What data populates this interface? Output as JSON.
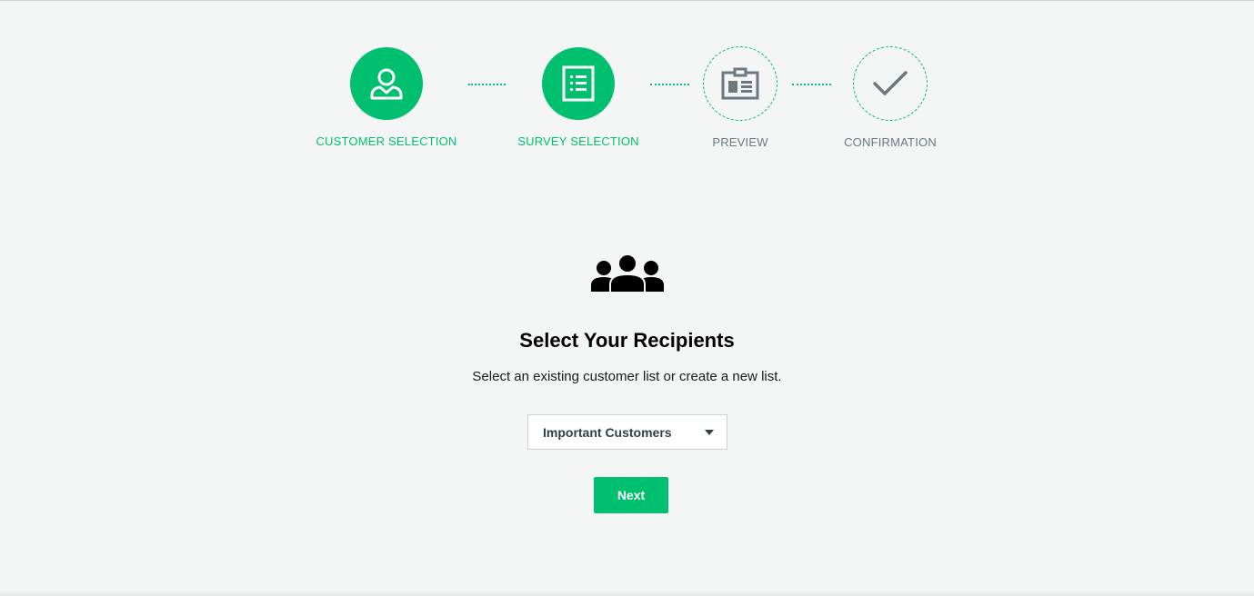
{
  "stepper": {
    "steps": [
      {
        "label": "CUSTOMER SELECTION",
        "icon": "person-icon",
        "state": "completed"
      },
      {
        "label": "SURVEY SELECTION",
        "icon": "survey-list-icon",
        "state": "completed"
      },
      {
        "label": "PREVIEW",
        "icon": "id-card-icon",
        "state": "pending"
      },
      {
        "label": "CONFIRMATION",
        "icon": "checkmark-icon",
        "state": "pending"
      }
    ]
  },
  "main": {
    "icon": "group-icon",
    "title": "Select Your Recipients",
    "subtitle": "Select an existing customer list or create a new list.",
    "recipient_list": {
      "selected": "Important Customers"
    },
    "next_label": "Next"
  },
  "colors": {
    "accent": "#00bf6f",
    "background": "#f4f5f5",
    "pending_text": "#6b787f",
    "pending_icon": "#6b787f"
  }
}
